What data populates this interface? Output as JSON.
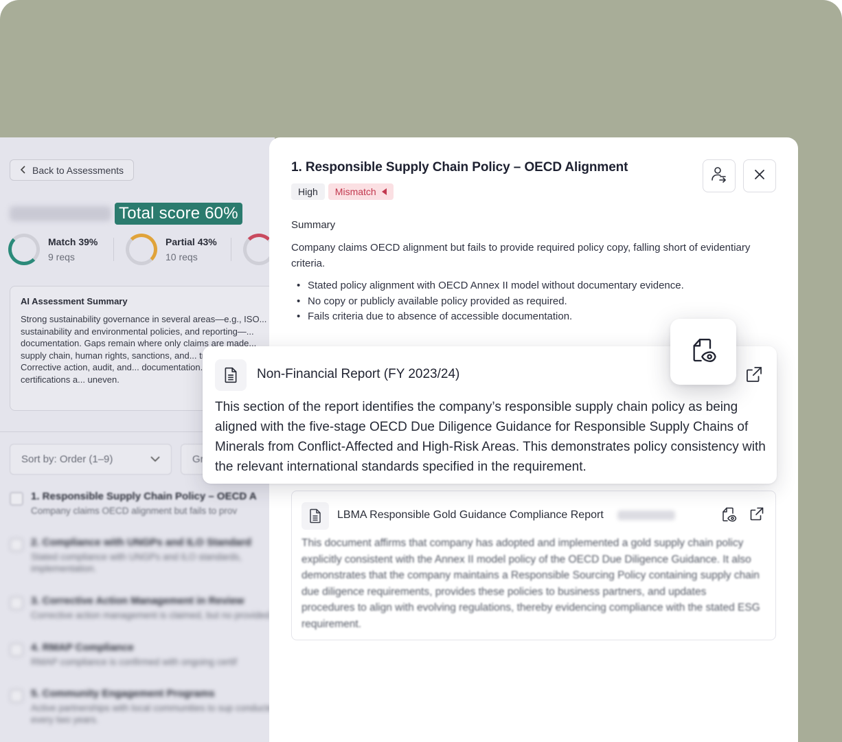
{
  "background": {
    "back_label": "Back to Assessments",
    "total_score": "Total score 60%",
    "gauges": [
      {
        "label": "Match 39%",
        "sub": "9 reqs"
      },
      {
        "label": "Partial 43%",
        "sub": "10 reqs"
      }
    ],
    "ai_summary": {
      "title": "AI Assessment Summary",
      "text": "Strong sustainability governance in several areas—e.g., ISO... sustainability and environmental policies, and reporting—... documentation. Gaps remain where only claims are made... supply chain, human rights, sanctions, and... transparency. Corrective action, audit, and... documentation. Site-level certifications a... uneven."
    },
    "sort_label": "Sort by: Order (1–9)",
    "group_label": "Gr",
    "requirements": [
      {
        "title": "1. Responsible Supply Chain Policy – OECD A",
        "desc": "Company claims OECD alignment but fails to prov"
      },
      {
        "title": "2. Compliance with UNGPs and ILO Standard",
        "desc": "Stated compliance with UNGPs and ILO standards, implementation."
      },
      {
        "title": "3. Corrective Action Management in Review",
        "desc": "Corrective action management is claimed, but no provided."
      },
      {
        "title": "4. RMAP Compliance",
        "desc": "RMAP compliance is confirmed with ongoing certif"
      },
      {
        "title": "5. Community Engagement Programs",
        "desc": "Active partnerships with local communities to sup conducted every two years."
      }
    ]
  },
  "panel": {
    "title": "1. Responsible Supply Chain Policy – OECD Alignment",
    "priority_badge": "High",
    "status_badge": "Mismatch",
    "summary_label": "Summary",
    "summary_text": "Company claims OECD alignment but fails to provide required policy copy, falling short of evidentiary criteria.",
    "bullets": [
      "Stated policy alignment with OECD Annex II model without documentary evidence.",
      "No copy or publicly available policy provided as required.",
      "Fails criteria due to absence of accessible documentation."
    ],
    "evidence": [
      {
        "title": "Non-Financial Report (FY 2023/24)",
        "text": "This section of the report identifies the company’s responsible supply chain policy as being aligned with the five-stage OECD Due Diligence Guidance for Responsible Supply Chains of Minerals from Conflict-Affected and High-Risk Areas. This demonstrates policy consistency with the relevant international standards specified in the requirement."
      },
      {
        "title": "LBMA Responsible Gold Guidance Compliance Report",
        "text": "This document affirms that company has adopted and implemented a gold supply chain policy explicitly consistent with the Annex II model policy of the OECD Due Diligence Guidance. It also demonstrates that the company maintains a Responsible Sourcing Policy containing supply chain due diligence requirements, provides these policies to business partners, and updates procedures to align with evolving regulations, thereby evidencing compliance with the stated ESG requirement."
      }
    ]
  },
  "icons": {
    "back": "chevron-left-icon",
    "assign": "user-share-icon",
    "close": "close-icon",
    "document": "document-icon",
    "preview": "document-preview-icon",
    "external": "external-link-icon"
  },
  "colors": {
    "backdrop": "#a8ad98",
    "score_badge": "#2b7b6e",
    "mismatch_bg": "#fbe0e3",
    "mismatch_text": "#c2394f",
    "match_ring": "#2b8a7a",
    "partial_ring": "#e0a33a"
  }
}
